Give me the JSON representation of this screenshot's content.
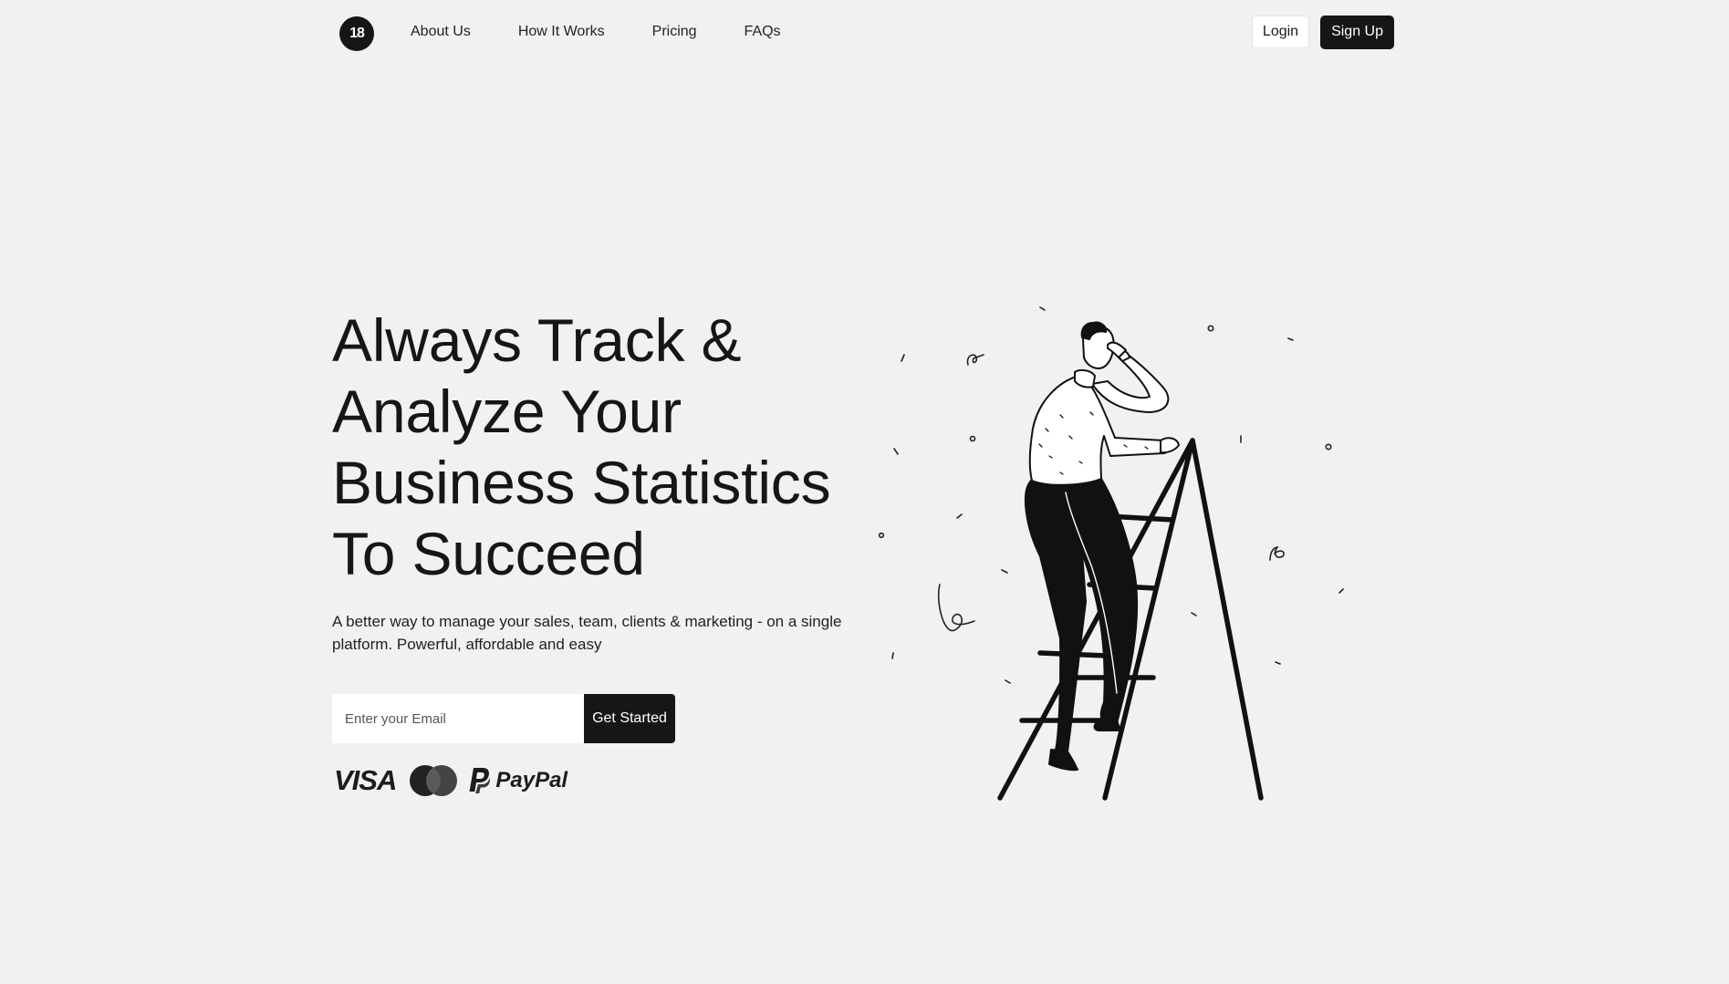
{
  "header": {
    "logo_text": "18",
    "nav_links": [
      "About Us",
      "How It Works",
      "Pricing",
      "FAQs"
    ],
    "login_label": "Login",
    "signup_label": "Sign Up"
  },
  "hero": {
    "title_lines": [
      "Always Track &",
      "Analyze Your",
      "Business Statistics",
      "To Succeed"
    ],
    "subtitle": "A better way to manage your sales, team, clients & marketing - on a single platform. Powerful, affordable and easy",
    "email_placeholder": "Enter your Email",
    "cta_label": "Get Started"
  },
  "payments": {
    "visa": "VISA",
    "mastercard": "mastercard-icon",
    "paypal_mark": "paypal-icon",
    "paypal": "PayPal"
  },
  "illustration": {
    "subject": "man-on-ladder-illustration"
  },
  "colors": {
    "background": "#f1f1f1",
    "primary": "#161616",
    "surface": "#ffffff"
  }
}
